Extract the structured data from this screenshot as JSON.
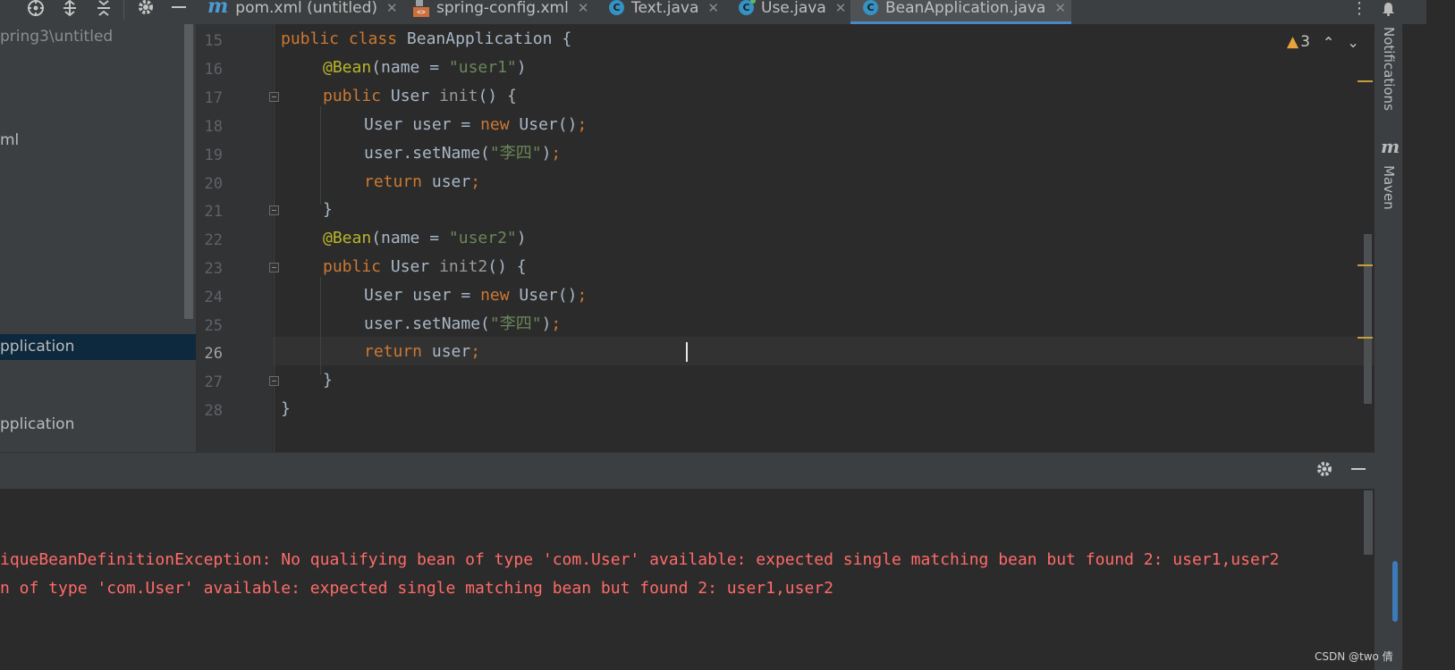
{
  "toolbar": {
    "icons": [
      "locate-icon",
      "expand-all-icon",
      "collapse-all-icon",
      "settings-icon",
      "hide-icon"
    ]
  },
  "tabs": [
    {
      "label": "pom.xml (untitled)",
      "icon": "maven-icon",
      "active": false
    },
    {
      "label": "spring-config.xml",
      "icon": "xml-file-icon",
      "active": false
    },
    {
      "label": "Text.java",
      "icon": "class-icon",
      "active": false
    },
    {
      "label": "Use.java",
      "icon": "class-icon",
      "active": false
    },
    {
      "label": "BeanApplication.java",
      "icon": "class-icon",
      "active": true
    }
  ],
  "project_tree": {
    "path": "pring3\\untitled",
    "item_xml": "ml",
    "item_selected": "pplication",
    "item_bottom": "pplication"
  },
  "editor": {
    "line_numbers": [
      "15",
      "16",
      "17",
      "18",
      "19",
      "20",
      "21",
      "22",
      "23",
      "24",
      "25",
      "26",
      "27",
      "28"
    ],
    "current_line": "26",
    "warnings_count": "3",
    "code": {
      "l15": {
        "kw1": "public",
        "kw2": "class",
        "name": "BeanApplication",
        "brace": "{"
      },
      "l16": {
        "ann": "@Bean",
        "open": "(name = ",
        "str": "\"user1\"",
        "close": ")"
      },
      "l17": {
        "kw": "public",
        "type": "User",
        "method": "init",
        "rest": "() {"
      },
      "l18": {
        "type": "User",
        "var": "user = ",
        "kw": "new",
        "call": "User()",
        "semi": ";"
      },
      "l19": {
        "call": "user.setName(",
        "str": "\"李四\"",
        "close": ")",
        "semi": ";"
      },
      "l20": {
        "kw": "return",
        "var": "user",
        "semi": ";"
      },
      "l21": {
        "brace": "}"
      },
      "l22": {
        "ann": "@Bean",
        "open": "(name = ",
        "str": "\"user2\"",
        "close": ")"
      },
      "l23": {
        "kw": "public",
        "type": "User",
        "method": "init2",
        "rest": "() {"
      },
      "l24": {
        "type": "User",
        "var": "user = ",
        "kw": "new",
        "call": "User()",
        "semi": ";"
      },
      "l25": {
        "call": "user.setName(",
        "str": "\"李四\"",
        "close": ")",
        "semi": ";"
      },
      "l26": {
        "kw": "return",
        "var": "user",
        "semi": ";"
      },
      "l27": {
        "brace": "}"
      },
      "l28": {
        "brace": "}"
      }
    }
  },
  "right_strip": {
    "notifications": "Notifications",
    "maven": "Maven",
    "maven_glyph": "m"
  },
  "console": {
    "line1": "iqueBeanDefinitionException: No qualifying bean of type 'com.User' available: expected single matching bean but found 2: user1,user2",
    "line2": "n of type 'com.User' available: expected single matching bean but found 2: user1,user2"
  },
  "watermark": "CSDN @two 倩",
  "colors": {
    "keyword": "#cc7832",
    "annotation": "#bbb529",
    "string": "#6a8759",
    "error": "#ff6b68",
    "accent": "#4a88c7"
  }
}
